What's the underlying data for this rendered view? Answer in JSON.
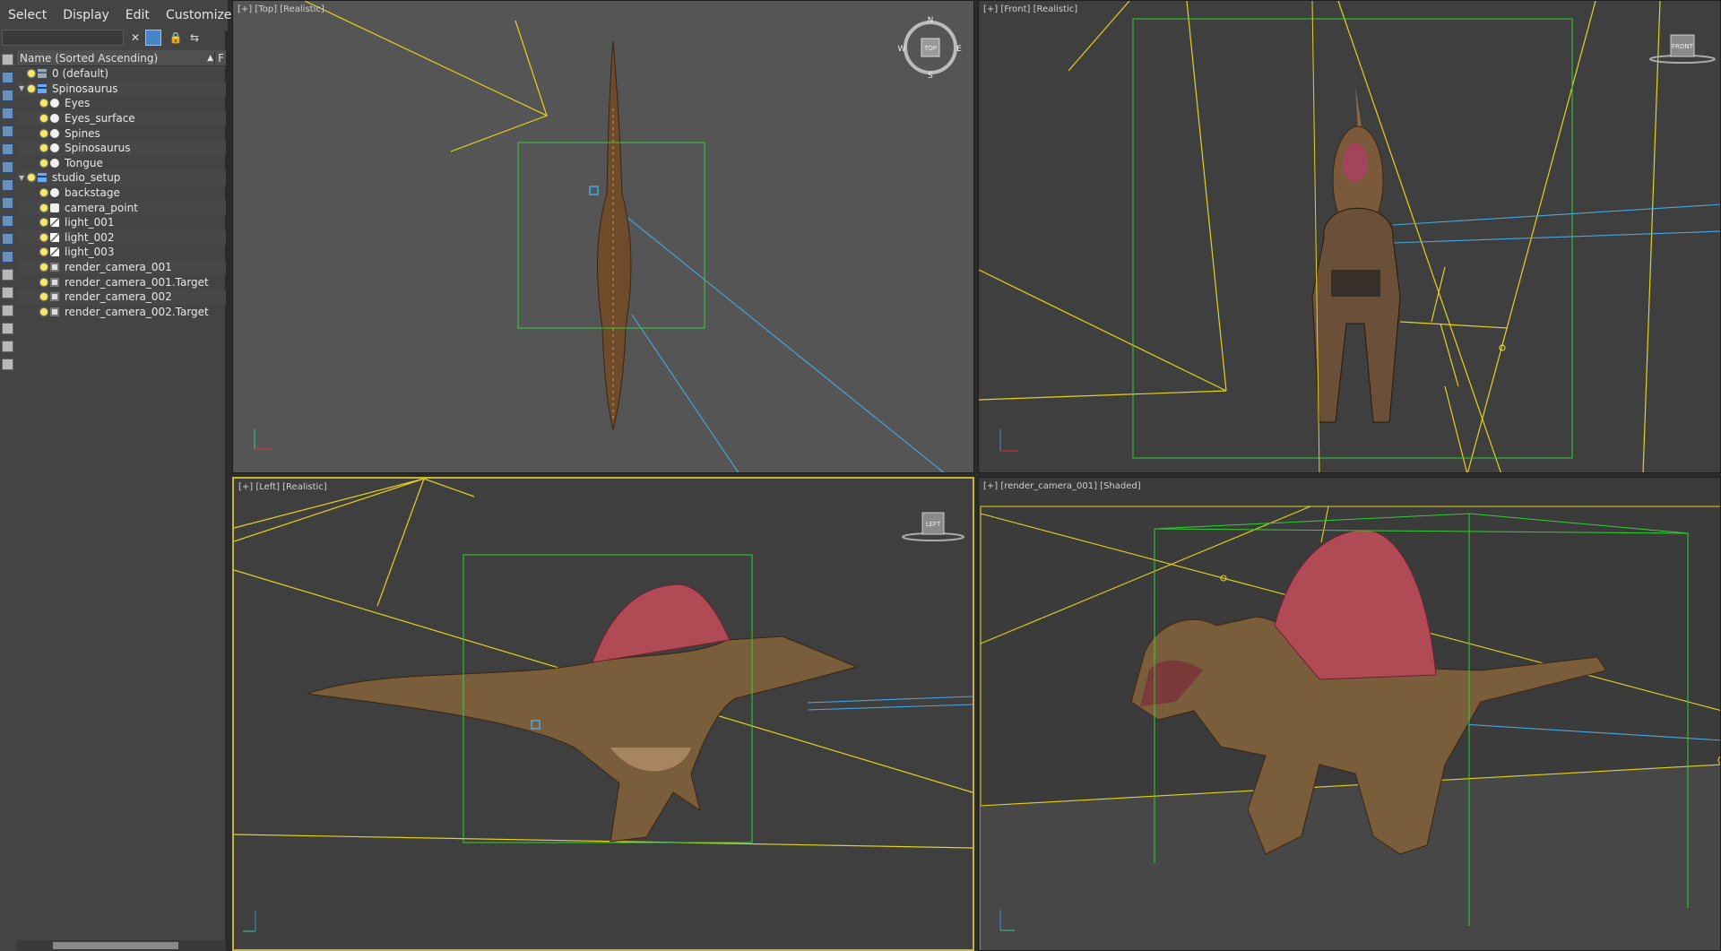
{
  "menu": [
    "Select",
    "Display",
    "Edit",
    "Customize"
  ],
  "search": {
    "value": ""
  },
  "tree": {
    "header": "Name (Sorted Ascending)",
    "col2": "F",
    "rows": [
      {
        "label": "0 (default)",
        "level": 0,
        "icon": "layer-icon",
        "expand": ""
      },
      {
        "label": "Spinosaurus",
        "level": 0,
        "icon": "layer-icon",
        "expand": "▼"
      },
      {
        "label": "Eyes",
        "level": 1,
        "icon": "sphere-icon",
        "expand": ""
      },
      {
        "label": "Eyes_surface",
        "level": 1,
        "icon": "sphere-icon",
        "expand": ""
      },
      {
        "label": "Spines",
        "level": 1,
        "icon": "sphere-icon",
        "expand": ""
      },
      {
        "label": "Spinosaurus",
        "level": 1,
        "icon": "sphere-icon",
        "expand": ""
      },
      {
        "label": "Tongue",
        "level": 1,
        "icon": "sphere-icon",
        "expand": ""
      },
      {
        "label": "studio_setup",
        "level": 0,
        "icon": "layer-icon",
        "expand": "▼"
      },
      {
        "label": "backstage",
        "level": 1,
        "icon": "sphere-icon",
        "expand": ""
      },
      {
        "label": "camera_point",
        "level": 1,
        "icon": "point-icon",
        "expand": ""
      },
      {
        "label": "light_001",
        "level": 1,
        "icon": "light-icon",
        "expand": ""
      },
      {
        "label": "light_002",
        "level": 1,
        "icon": "light-icon",
        "expand": ""
      },
      {
        "label": "light_003",
        "level": 1,
        "icon": "light-icon",
        "expand": ""
      },
      {
        "label": "render_camera_001",
        "level": 1,
        "icon": "camera-icon",
        "expand": ""
      },
      {
        "label": "render_camera_001.Target",
        "level": 1,
        "icon": "camera-icon",
        "expand": ""
      },
      {
        "label": "render_camera_002",
        "level": 1,
        "icon": "camera-icon",
        "expand": ""
      },
      {
        "label": "render_camera_002.Target",
        "level": 1,
        "icon": "camera-icon",
        "expand": ""
      }
    ]
  },
  "viewports": {
    "top": {
      "label": "[+] [Top] [Realistic]",
      "viewcube": "TOP",
      "compass": [
        "N",
        "E",
        "S",
        "W"
      ]
    },
    "front": {
      "label": "[+] [Front] [Realistic]",
      "viewcube": "FRONT"
    },
    "left": {
      "label": "[+] [Left] [Realistic]",
      "viewcube": "LEFT"
    },
    "camera": {
      "label": "[+] [render_camera_001] [Shaded]"
    }
  },
  "colors": {
    "active_border": "#c7b23a",
    "selection_box": "#2fd12f",
    "light_lines": "#e6d21a",
    "camera_lines": "#4aa8e0"
  }
}
